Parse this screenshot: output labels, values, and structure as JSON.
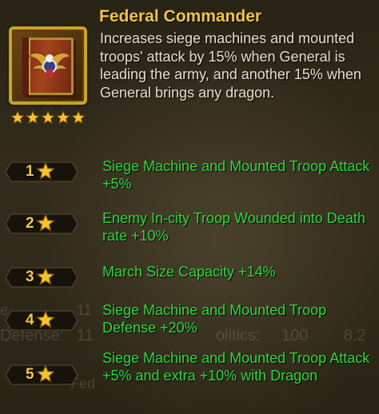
{
  "skill": {
    "title": "Federal Commander",
    "description": "Increases siege machines and mounted troops' attack by 15% when General is leading the army, and another 15% when General brings any dragon.",
    "stars": 5,
    "icon": "eagle-book-icon"
  },
  "levels": [
    {
      "level": "1",
      "text": "Siege Machine and Mounted Troop Attack +5%"
    },
    {
      "level": "2",
      "text": "Enemy In-city Troop Wounded into Death rate +10%"
    },
    {
      "level": "3",
      "text": "March Size Capacity +14%"
    },
    {
      "level": "4",
      "text": "Siege Machine and Mounted Troop Defense +20%"
    },
    {
      "level": "5",
      "text": "Siege Machine and Mounted Troop Attack +5% and extra +10% with Dragon"
    }
  ],
  "colors": {
    "title": "#f1c34d",
    "description": "#e6dfcf",
    "bonus_text": "#2fd63a",
    "background": "#2c2618",
    "gold": "#f3c54b"
  }
}
